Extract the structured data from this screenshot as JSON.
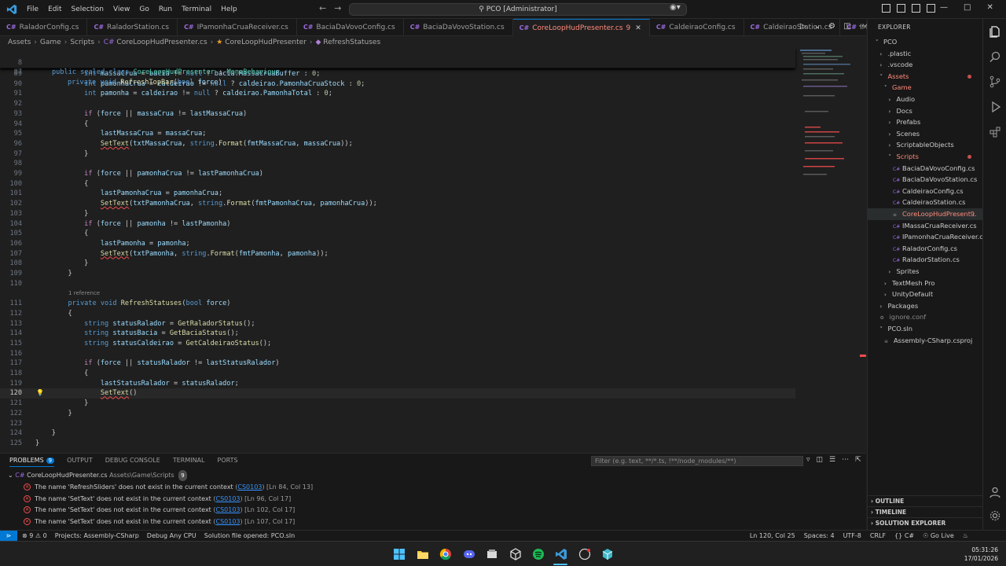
{
  "titlebar": {
    "menus": [
      "File",
      "Edit",
      "Selection",
      "View",
      "Go",
      "Run",
      "Terminal",
      "Help"
    ],
    "command_center": "PCO [Administrator]"
  },
  "tabs": [
    {
      "label": "RaladorConfig.cs",
      "active": false
    },
    {
      "label": "RaladorStation.cs",
      "active": false
    },
    {
      "label": "IPamonhaCruaReceiver.cs",
      "active": false
    },
    {
      "label": "BaciaDaVovoConfig.cs",
      "active": false
    },
    {
      "label": "BaciaDaVovoStation.cs",
      "active": false
    },
    {
      "label": "CoreLoopHudPresenter.cs",
      "active": true,
      "badge": "9"
    },
    {
      "label": "CaldeiraoConfig.cs",
      "active": false
    },
    {
      "label": "CaldeiraoStation.cs",
      "active": false
    },
    {
      "label": "IMass",
      "active": false
    }
  ],
  "breadcrumb": [
    "Assets",
    "Game",
    "Scripts",
    "CoreLoopHudPresenter.cs",
    "CoreLoopHudPresenter",
    "RefreshStatuses"
  ],
  "sticky": [
    {
      "n": "8",
      "text": "public sealed class CoreLoopHudPresenter : MonoBehaviour"
    },
    {
      "n": "87",
      "text": "private void RefreshTopBar(bool force)"
    }
  ],
  "code_lines": [
    {
      "n": "89",
      "text": "int massaCrua = bacia != null ? bacia.MassaCruaBuffer : 0;"
    },
    {
      "n": "90",
      "text": "int pamonhaCrua = caldeirao != null ? caldeirao.PamonhaCruaStock : 0;"
    },
    {
      "n": "91",
      "text": "int pamonha = caldeirao != null ? caldeirao.PamonhaTotal : 0;"
    },
    {
      "n": "92",
      "text": ""
    },
    {
      "n": "93",
      "text": "if (force || massaCrua != lastMassaCrua)"
    },
    {
      "n": "94",
      "text": "{"
    },
    {
      "n": "95",
      "text": "lastMassaCrua = massaCrua;"
    },
    {
      "n": "96",
      "text": "SetText(txtMassaCrua, string.Format(fmtMassaCrua, massaCrua));"
    },
    {
      "n": "97",
      "text": "}"
    },
    {
      "n": "98",
      "text": ""
    },
    {
      "n": "99",
      "text": "if (force || pamonhaCrua != lastPamonhaCrua)"
    },
    {
      "n": "100",
      "text": "{"
    },
    {
      "n": "101",
      "text": "lastPamonhaCrua = pamonhaCrua;"
    },
    {
      "n": "102",
      "text": "SetText(txtPamonhaCrua, string.Format(fmtPamonhaCrua, pamonhaCrua));"
    },
    {
      "n": "103",
      "text": "}"
    },
    {
      "n": "104",
      "text": "if (force || pamonha != lastPamonha)"
    },
    {
      "n": "105",
      "text": "{"
    },
    {
      "n": "106",
      "text": "lastPamonha = pamonha;"
    },
    {
      "n": "107",
      "text": "SetText(txtPamonha, string.Format(fmtPamonha, pamonha));"
    },
    {
      "n": "108",
      "text": "}"
    },
    {
      "n": "109",
      "text": "}"
    },
    {
      "n": "110",
      "text": ""
    },
    {
      "n": "111",
      "text": "private void RefreshStatuses(bool force)",
      "ref": "1 reference"
    },
    {
      "n": "112",
      "text": "{"
    },
    {
      "n": "113",
      "text": "string statusRalador = GetRaladorStatus();"
    },
    {
      "n": "114",
      "text": "string statusBacia = GetBaciaStatus();"
    },
    {
      "n": "115",
      "text": "string statusCaldeirao = GetCaldeiraoStatus();"
    },
    {
      "n": "116",
      "text": ""
    },
    {
      "n": "117",
      "text": "if (force || statusRalador != lastStatusRalador)"
    },
    {
      "n": "118",
      "text": "{"
    },
    {
      "n": "119",
      "text": "lastStatusRalador = statusRalador;"
    },
    {
      "n": "120",
      "text": "SetText()"
    },
    {
      "n": "121",
      "text": "}"
    },
    {
      "n": "122",
      "text": "}"
    },
    {
      "n": "123",
      "text": ""
    },
    {
      "n": "124",
      "text": "}"
    },
    {
      "n": "125",
      "text": "}"
    }
  ],
  "panel": {
    "tabs": [
      "PROBLEMS",
      "OUTPUT",
      "DEBUG CONSOLE",
      "TERMINAL",
      "PORTS"
    ],
    "problems_count": "9",
    "filter_placeholder": "Filter (e.g. text, **/*.ts, !**/node_modules/**)",
    "file": "CoreLoopHudPresenter.cs",
    "file_path": "Assets\\Game\\Scripts",
    "file_count": "9",
    "problems": [
      {
        "message": "The name 'RefreshSliders' does not exist in the current context",
        "code": "CS0103",
        "loc": "[Ln 84, Col 13]"
      },
      {
        "message": "The name 'SetText' does not exist in the current context",
        "code": "CS0103",
        "loc": "[Ln 96, Col 17]"
      },
      {
        "message": "The name 'SetText' does not exist in the current context",
        "code": "CS0103",
        "loc": "[Ln 102, Col 17]"
      },
      {
        "message": "The name 'SetText' does not exist in the current context",
        "code": "CS0103",
        "loc": "[Ln 107, Col 17]"
      }
    ]
  },
  "explorer": {
    "title": "EXPLORER",
    "tree": [
      {
        "label": "PCO",
        "chev": "v",
        "indent": 0
      },
      {
        "label": ".plastic",
        "chev": ">",
        "indent": 1
      },
      {
        "label": ".vscode",
        "chev": ">",
        "indent": 1
      },
      {
        "label": "Assets",
        "chev": "v",
        "indent": 1,
        "red": true,
        "dot": true
      },
      {
        "label": "Game",
        "chev": "v",
        "indent": 2,
        "red": true
      },
      {
        "label": "Audio",
        "chev": ">",
        "indent": 3
      },
      {
        "label": "Docs",
        "chev": ">",
        "indent": 3
      },
      {
        "label": "Prefabs",
        "chev": ">",
        "indent": 3
      },
      {
        "label": "Scenes",
        "chev": ">",
        "indent": 3
      },
      {
        "label": "ScriptableObjects",
        "chev": ">",
        "indent": 3
      },
      {
        "label": "Scripts",
        "chev": "v",
        "indent": 3,
        "red": true,
        "dot": true
      },
      {
        "label": "BaciaDaVovoConfig.cs",
        "indent": 4
      },
      {
        "label": "BaciaDaVovoStation.cs",
        "indent": 4
      },
      {
        "label": "CaldeiraoConfig.cs",
        "indent": 4
      },
      {
        "label": "CaldeiraoStation.cs",
        "indent": 4
      },
      {
        "label": "CoreLoopHudPresent...",
        "indent": 4,
        "red": true,
        "selected": true,
        "count": "9"
      },
      {
        "label": "IMassaCruaReceiver.cs",
        "indent": 4
      },
      {
        "label": "IPamonhaCruaReceiver.cs",
        "indent": 4
      },
      {
        "label": "RaladorConfig.cs",
        "indent": 4
      },
      {
        "label": "RaladorStation.cs",
        "indent": 4
      },
      {
        "label": "Sprites",
        "chev": ">",
        "indent": 3
      },
      {
        "label": "TextMesh Pro",
        "chev": ">",
        "indent": 2
      },
      {
        "label": "UnityDefault",
        "chev": ">",
        "indent": 2
      },
      {
        "label": "Packages",
        "chev": ">",
        "indent": 1
      },
      {
        "label": "ignore.conf",
        "indent": 1,
        "gray": true
      },
      {
        "label": "PCO.sln",
        "chev": "v",
        "indent": 1
      },
      {
        "label": "Assembly-CSharp.csproj",
        "indent": 2
      }
    ],
    "sections": [
      "OUTLINE",
      "TIMELINE",
      "SOLUTION EXPLORER"
    ]
  },
  "statusbar": {
    "errors": "9",
    "warnings": "0",
    "project": "Projects: Assembly-CSharp",
    "debug": "Debug Any CPU",
    "solution": "Solution file opened: PCO.sln",
    "position": "Ln 120, Col 25",
    "spaces": "Spaces: 4",
    "encoding": "UTF-8",
    "eol": "CRLF",
    "language": "C#",
    "golive": "Go Live"
  },
  "clock": {
    "time": "05:31:26",
    "date": "17/01/2026"
  },
  "colors": {
    "accent": "#0078d4",
    "error": "#f14c4c",
    "modified": "#ff8a7a"
  }
}
